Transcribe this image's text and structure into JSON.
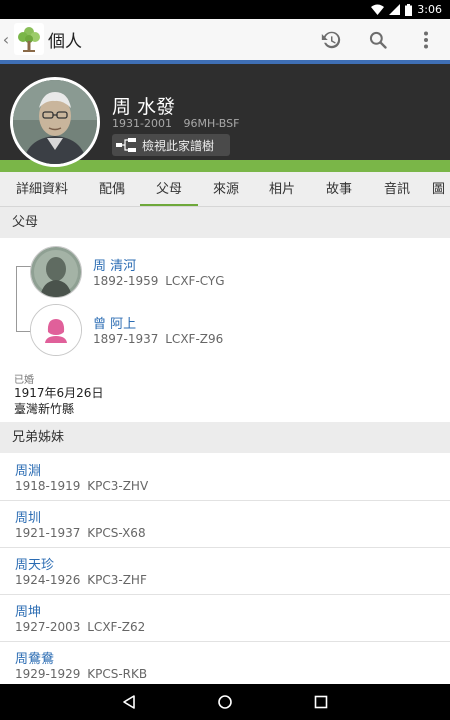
{
  "status": {
    "time": "3:06"
  },
  "appbar": {
    "title": "個人",
    "back_icon": "chevron-left-icon",
    "history_icon": "history-icon",
    "search_icon": "search-icon",
    "menu_icon": "more-vert-icon"
  },
  "person": {
    "name": "周 水發",
    "lifespan": "1931-2001",
    "pid": "96MH-BSF",
    "tree_button": "檢視此家譜樹"
  },
  "tabs": [
    "詳細資料",
    "配偶",
    "父母",
    "來源",
    "相片",
    "故事",
    "音訊",
    "圖"
  ],
  "active_tab": "父母",
  "parents": {
    "heading": "父母",
    "father": {
      "name": "周 清河",
      "lifespan": "1892-1959",
      "pid": "LCXF-CYG"
    },
    "mother": {
      "name": "曾 阿上",
      "lifespan": "1897-1937",
      "pid": "LCXF-Z96"
    },
    "marriage": {
      "label": "已婚",
      "date": "1917年6月26日",
      "place": "臺灣新竹縣"
    }
  },
  "siblings": {
    "heading": "兄弟姊妹",
    "items": [
      {
        "name": "周淵",
        "lifespan": "1918-1919",
        "pid": "KPC3-ZHV"
      },
      {
        "name": "周圳",
        "lifespan": "1921-1937",
        "pid": "KPCS-X68"
      },
      {
        "name": "周天珍",
        "lifespan": "1924-1926",
        "pid": "KPC3-ZHF"
      },
      {
        "name": "周坤",
        "lifespan": "1927-2003",
        "pid": "LCXF-Z62"
      },
      {
        "name": "周鴦鴦",
        "lifespan": "1929-1929",
        "pid": "KPCS-RKB"
      }
    ]
  },
  "colors": {
    "accent_blue": "#3f6fb5",
    "accent_green": "#7ab648",
    "link": "#2b6cb3",
    "header_bg": "#2e2e2e",
    "female": "#e0609a"
  }
}
